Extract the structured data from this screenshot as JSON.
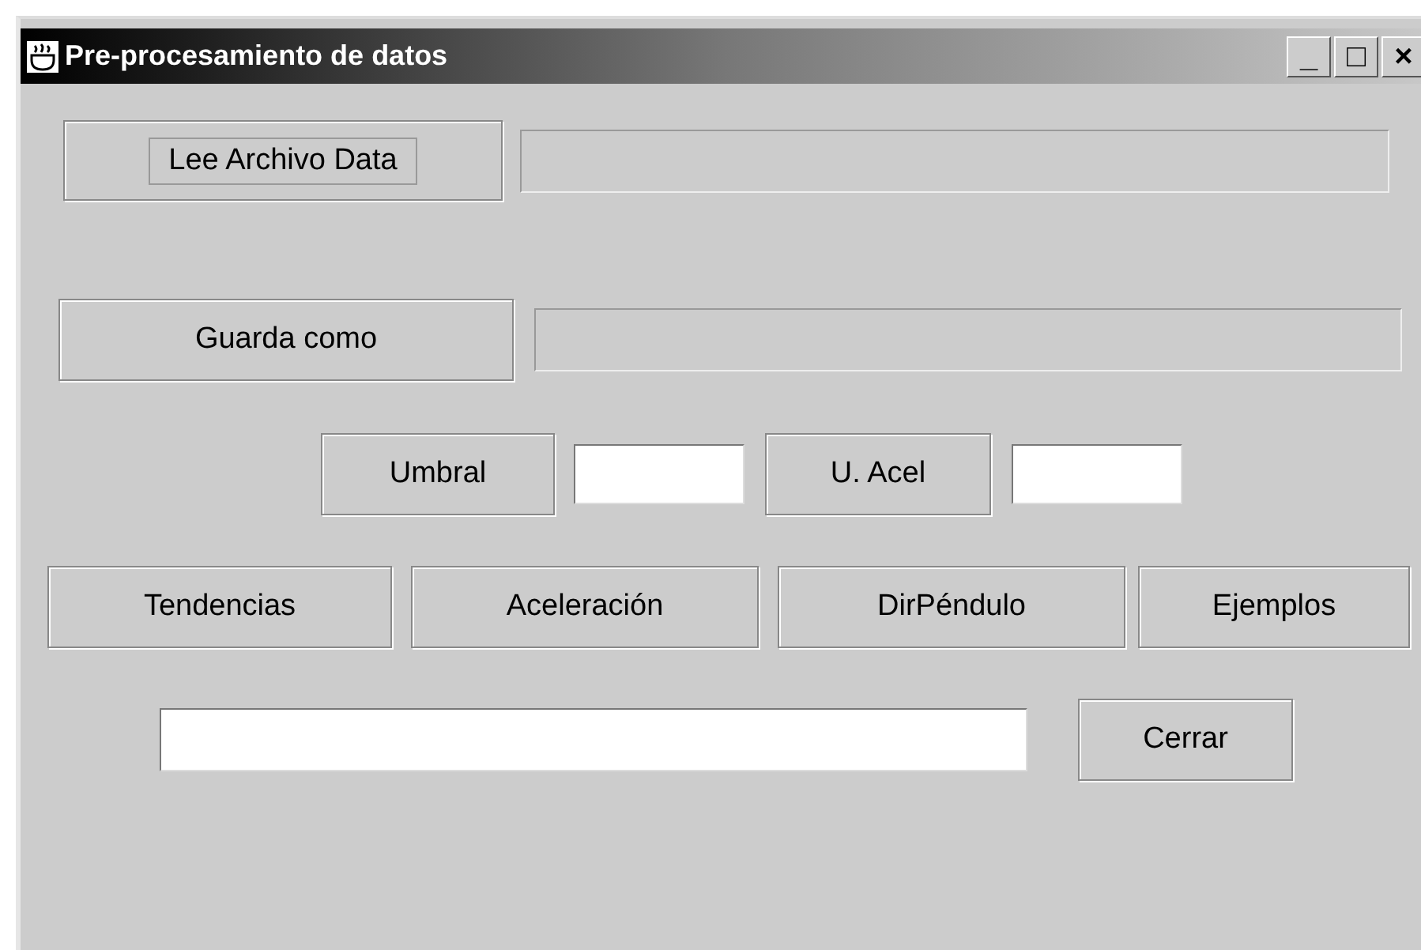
{
  "window": {
    "title": "Pre-procesamiento de datos",
    "controls": [
      "_",
      "□",
      "×"
    ]
  },
  "rows": [
    {
      "items": [
        {
          "kind": "button",
          "label": "Lee Archivo Data",
          "focused": true
        },
        {
          "kind": "field",
          "editable": false
        }
      ]
    },
    {
      "items": [
        {
          "kind": "button",
          "label": "Guarda como",
          "focused": false
        },
        {
          "kind": "field",
          "editable": false
        }
      ]
    },
    {
      "items": [
        {
          "kind": "button",
          "label": "Umbral",
          "focused": false
        },
        {
          "kind": "field",
          "editable": true
        },
        {
          "kind": "button",
          "label": "U. Acel",
          "focused": false
        },
        {
          "kind": "field",
          "editable": true
        }
      ]
    },
    {
      "items": [
        {
          "kind": "button",
          "label": "Tendencias",
          "focused": false
        },
        {
          "kind": "button",
          "label": "Aceleración",
          "focused": false
        },
        {
          "kind": "button",
          "label": "DirPéndulo",
          "focused": false
        },
        {
          "kind": "button",
          "label": "Ejemplos",
          "focused": false
        }
      ]
    },
    {
      "items": [
        {
          "kind": "field",
          "editable": true
        },
        {
          "kind": "button",
          "label": "Cerrar",
          "focused": false
        }
      ]
    }
  ]
}
